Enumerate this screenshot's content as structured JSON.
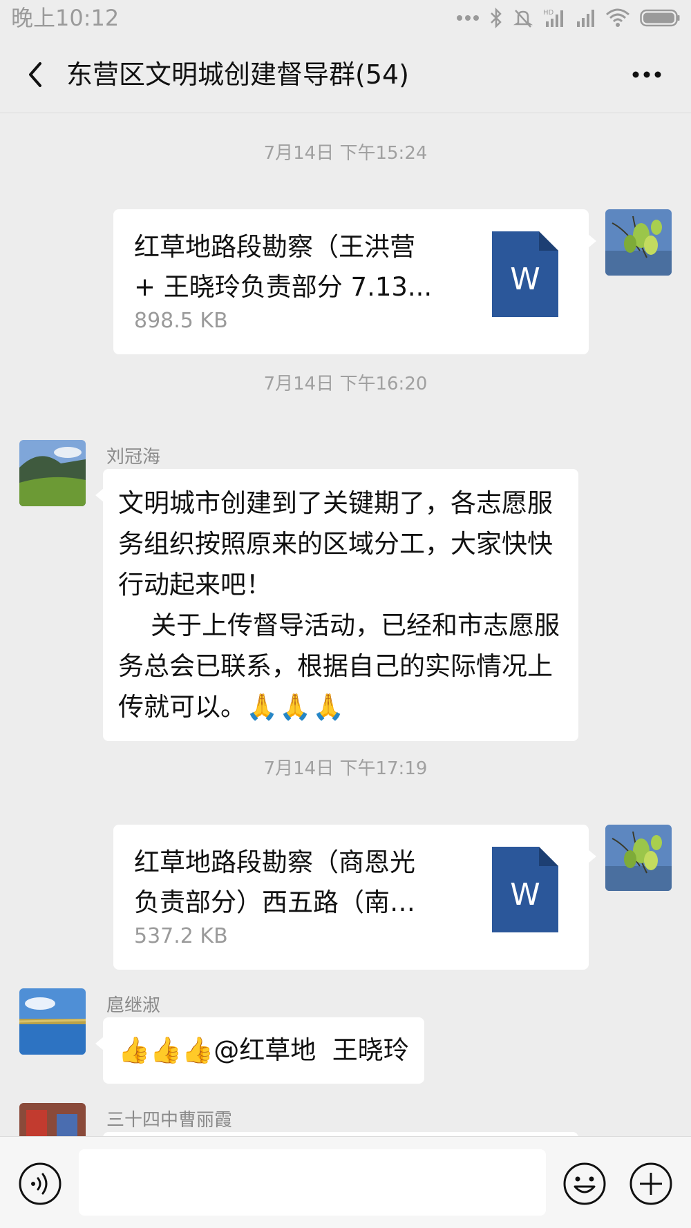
{
  "status_bar": {
    "time": "晚上10:12",
    "icons": [
      "dots-icon",
      "bluetooth-icon",
      "mute-icon",
      "hd-signal-icon",
      "signal-icon",
      "wifi-icon",
      "battery-icon"
    ]
  },
  "header": {
    "title": "东营区文明城创建督导群(54)"
  },
  "messages": [
    {
      "type": "timestamp",
      "text": "7月14日 下午15:24"
    },
    {
      "type": "file",
      "direction": "sent",
      "file_name": "红草地路段勘察（王洪营 + 王晓玲负责部分 7.13...",
      "file_size": "898.5 KB",
      "file_type": "W"
    },
    {
      "type": "timestamp",
      "text": "7月14日 下午16:20"
    },
    {
      "type": "text",
      "direction": "received",
      "sender": "刘冠海",
      "text": "文明城市创建到了关键期了，各志愿服务组织按照原来的区域分工，大家快快行动起来吧！\n    关于上传督导活动，已经和市志愿服务总会已联系，根据自己的实际情况上传就可以。",
      "emoji": "🙏🙏🙏"
    },
    {
      "type": "timestamp",
      "text": "7月14日 下午17:19"
    },
    {
      "type": "file",
      "direction": "sent",
      "file_name": "红草地路段勘察（商恩光负责部分）西五路（南一...",
      "file_size": "537.2 KB",
      "file_type": "W"
    },
    {
      "type": "text",
      "direction": "received",
      "sender": "扈继淑",
      "emoji": "👍👍👍",
      "text": "@红草地  王晓玲"
    },
    {
      "type": "partial",
      "direction": "received",
      "sender": "三十四中曹丽霞"
    }
  ],
  "input_bar": {
    "placeholder": ""
  },
  "colors": {
    "background": "#ededed",
    "bubble": "#ffffff",
    "word_icon": "#2b579a",
    "timestamp": "#a0a0a0"
  }
}
